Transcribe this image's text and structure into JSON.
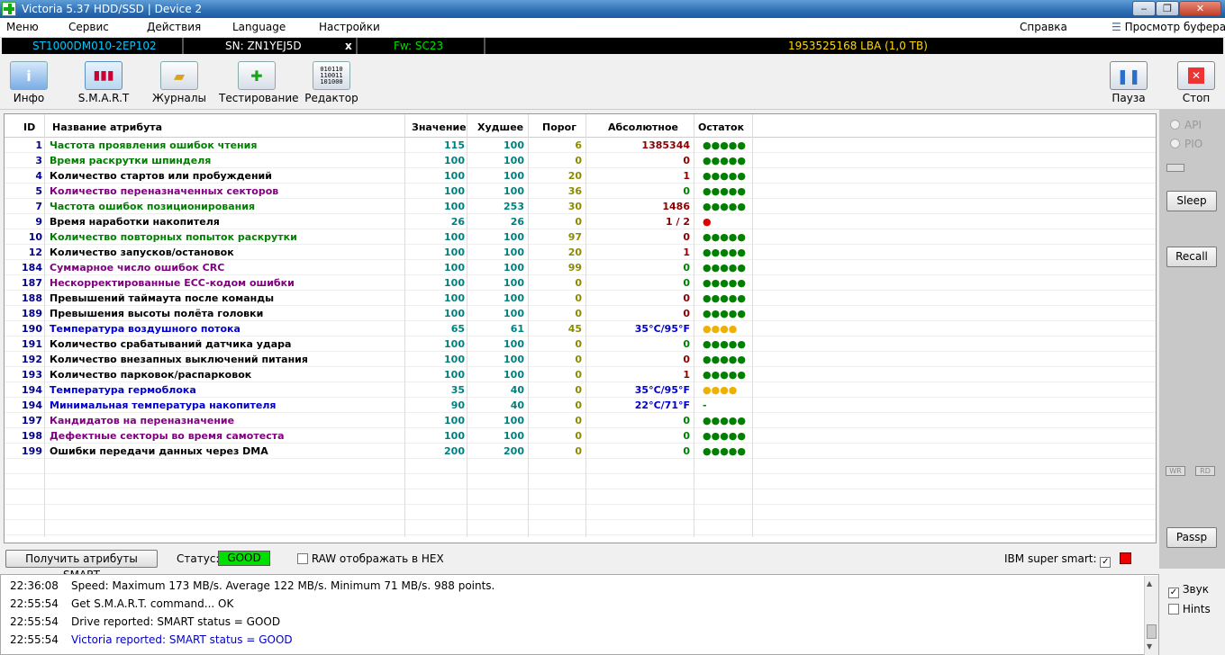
{
  "window": {
    "title": "Victoria 5.37 HDD/SSD | Device 2"
  },
  "menu": {
    "items": [
      "Меню",
      "Сервис",
      "Действия",
      "Language",
      "Настройки"
    ],
    "help": "Справка",
    "buffer": "Просмотр буфера"
  },
  "device": {
    "model": "ST1000DM010-2EP102",
    "serial": "SN: ZN1YEJ5D",
    "x": "x",
    "firmware": "Fw: SC23",
    "lba": "1953525168 LBA (1,0 TB)"
  },
  "toolbar": {
    "info": "Инфо",
    "smart": "S.M.A.R.T",
    "logs": "Журналы",
    "test": "Тестирование",
    "editor": "Редактор",
    "pause": "Пауза",
    "stop": "Стоп"
  },
  "table": {
    "headers": {
      "id": "ID",
      "name": "Название атрибута",
      "value": "Значение",
      "worst": "Худшее",
      "threshold": "Порог",
      "raw": "Абсолютное",
      "remain": "Остаток"
    },
    "rows": [
      {
        "id": "1",
        "name": "Частота проявления ошибок чтения",
        "value": "115",
        "worst": "100",
        "threshold": "6",
        "raw": "1385344",
        "remain": "●●●●●",
        "nameColor": "#008000",
        "rawColor": "#8b0000",
        "remainColor": "#008000"
      },
      {
        "id": "3",
        "name": "Время раскрутки шпинделя",
        "value": "100",
        "worst": "100",
        "threshold": "0",
        "raw": "0",
        "remain": "●●●●●",
        "nameColor": "#008000",
        "rawColor": "#8b0000",
        "remainColor": "#008000"
      },
      {
        "id": "4",
        "name": "Количество стартов или пробуждений",
        "value": "100",
        "worst": "100",
        "threshold": "20",
        "raw": "1",
        "remain": "●●●●●",
        "nameColor": "#000000",
        "rawColor": "#8b0000",
        "remainColor": "#008000"
      },
      {
        "id": "5",
        "name": "Количество переназначенных секторов",
        "value": "100",
        "worst": "100",
        "threshold": "36",
        "raw": "0",
        "remain": "●●●●●",
        "nameColor": "#800080",
        "rawColor": "#008000",
        "remainColor": "#008000"
      },
      {
        "id": "7",
        "name": "Частота ошибок позиционирования",
        "value": "100",
        "worst": "253",
        "threshold": "30",
        "raw": "1486",
        "remain": "●●●●●",
        "nameColor": "#008000",
        "rawColor": "#8b0000",
        "remainColor": "#008000"
      },
      {
        "id": "9",
        "name": "Время наработки накопителя",
        "value": "26",
        "worst": "26",
        "threshold": "0",
        "raw": "1 / 2",
        "remain": "●",
        "nameColor": "#000000",
        "rawColor": "#8b0000",
        "remainColor": "#e00000"
      },
      {
        "id": "10",
        "name": "Количество повторных попыток раскрутки",
        "value": "100",
        "worst": "100",
        "threshold": "97",
        "raw": "0",
        "remain": "●●●●●",
        "nameColor": "#008000",
        "rawColor": "#8b0000",
        "remainColor": "#008000"
      },
      {
        "id": "12",
        "name": "Количество запусков/остановок",
        "value": "100",
        "worst": "100",
        "threshold": "20",
        "raw": "1",
        "remain": "●●●●●",
        "nameColor": "#000000",
        "rawColor": "#8b0000",
        "remainColor": "#008000"
      },
      {
        "id": "184",
        "name": "Суммарное число ошибок CRC",
        "value": "100",
        "worst": "100",
        "threshold": "99",
        "raw": "0",
        "remain": "●●●●●",
        "nameColor": "#800080",
        "rawColor": "#008000",
        "remainColor": "#008000"
      },
      {
        "id": "187",
        "name": "Нескорректированные ECC-кодом ошибки",
        "value": "100",
        "worst": "100",
        "threshold": "0",
        "raw": "0",
        "remain": "●●●●●",
        "nameColor": "#800080",
        "rawColor": "#008000",
        "remainColor": "#008000"
      },
      {
        "id": "188",
        "name": "Превышений таймаута после команды",
        "value": "100",
        "worst": "100",
        "threshold": "0",
        "raw": "0",
        "remain": "●●●●●",
        "nameColor": "#000000",
        "rawColor": "#8b0000",
        "remainColor": "#008000"
      },
      {
        "id": "189",
        "name": "Превышения высоты полёта головки",
        "value": "100",
        "worst": "100",
        "threshold": "0",
        "raw": "0",
        "remain": "●●●●●",
        "nameColor": "#000000",
        "rawColor": "#8b0000",
        "remainColor": "#008000"
      },
      {
        "id": "190",
        "name": "Температура воздушного потока",
        "value": "65",
        "worst": "61",
        "threshold": "45",
        "raw": "35°C/95°F",
        "remain": "●●●●",
        "nameColor": "#0000cc",
        "rawColor": "#0000cc",
        "remainColor": "#f0b000"
      },
      {
        "id": "191",
        "name": "Количество срабатываний датчика удара",
        "value": "100",
        "worst": "100",
        "threshold": "0",
        "raw": "0",
        "remain": "●●●●●",
        "nameColor": "#000000",
        "rawColor": "#008000",
        "remainColor": "#008000"
      },
      {
        "id": "192",
        "name": "Количество внезапных выключений питания",
        "value": "100",
        "worst": "100",
        "threshold": "0",
        "raw": "0",
        "remain": "●●●●●",
        "nameColor": "#000000",
        "rawColor": "#8b0000",
        "remainColor": "#008000"
      },
      {
        "id": "193",
        "name": "Количество парковок/распарковок",
        "value": "100",
        "worst": "100",
        "threshold": "0",
        "raw": "1",
        "remain": "●●●●●",
        "nameColor": "#000000",
        "rawColor": "#8b0000",
        "remainColor": "#008000"
      },
      {
        "id": "194",
        "name": "Температура гермоблока",
        "value": "35",
        "worst": "40",
        "threshold": "0",
        "raw": "35°C/95°F",
        "remain": "●●●●",
        "nameColor": "#0000cc",
        "rawColor": "#0000cc",
        "remainColor": "#f0b000"
      },
      {
        "id": "194",
        "name": "Минимальная температура накопителя",
        "value": "90",
        "worst": "40",
        "threshold": "0",
        "raw": "22°C/71°F",
        "remain": "-",
        "nameColor": "#0000cc",
        "rawColor": "#0000cc",
        "remainColor": "#008000"
      },
      {
        "id": "197",
        "name": "Кандидатов на переназначение",
        "value": "100",
        "worst": "100",
        "threshold": "0",
        "raw": "0",
        "remain": "●●●●●",
        "nameColor": "#800080",
        "rawColor": "#008000",
        "remainColor": "#008000"
      },
      {
        "id": "198",
        "name": "Дефектные секторы во время самотеста",
        "value": "100",
        "worst": "100",
        "threshold": "0",
        "raw": "0",
        "remain": "●●●●●",
        "nameColor": "#800080",
        "rawColor": "#008000",
        "remainColor": "#008000"
      },
      {
        "id": "199",
        "name": "Ошибки передачи данных через DMA",
        "value": "200",
        "worst": "200",
        "threshold": "0",
        "raw": "0",
        "remain": "●●●●●",
        "nameColor": "#000000",
        "rawColor": "#008000",
        "remainColor": "#008000"
      }
    ]
  },
  "side": {
    "api": "API",
    "pio": "PIO",
    "sleep": "Sleep",
    "recall": "Recall",
    "wr": "WR",
    "rd": "RD",
    "passp": "Passp"
  },
  "status": {
    "get_smart": "Получить атрибуты SMART",
    "label": "Статус:",
    "value": "GOOD",
    "raw_hex": "RAW отображать в HEX",
    "ibm": "IBM super smart:"
  },
  "log": [
    {
      "time": "22:36:08",
      "msg": "Speed: Maximum 173 MB/s. Average 122 MB/s. Minimum 71 MB/s. 988 points.",
      "color": "#000000"
    },
    {
      "time": "22:55:54",
      "msg": "Get S.M.A.R.T. command... OK",
      "color": "#000000"
    },
    {
      "time": "22:55:54",
      "msg": "Drive reported: SMART status = GOOD",
      "color": "#000000"
    },
    {
      "time": "22:55:54",
      "msg": "Victoria reported: SMART status = GOOD",
      "color": "#0000cc"
    }
  ],
  "options": {
    "sound": "Звук",
    "hints": "Hints"
  }
}
